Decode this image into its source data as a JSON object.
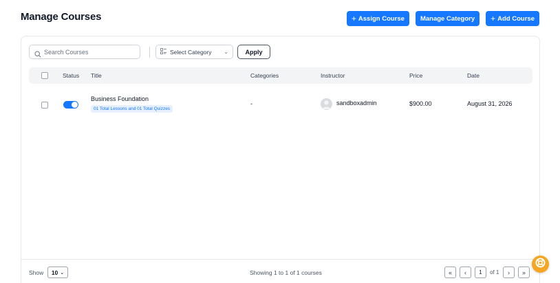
{
  "page": {
    "title": "Manage Courses"
  },
  "actions": {
    "assign_course": "Assign Course",
    "manage_category": "Manage Category",
    "add_course": "Add Course"
  },
  "filters": {
    "search_placeholder": "Search Courses",
    "category_select": "Select Category",
    "apply": "Apply"
  },
  "table": {
    "headers": {
      "status": "Status",
      "title": "Title",
      "categories": "Categories",
      "instructor": "Instructor",
      "price": "Price",
      "date": "Date"
    },
    "rows": [
      {
        "title": "Business Foundation",
        "summary": "01 Total Lessons and 01 Total Quizzes",
        "categories": "-",
        "instructor": "sandboxadmin",
        "price": "$900.00",
        "date": "August 31, 2026",
        "status_on": true
      }
    ]
  },
  "footer": {
    "show_label": "Show",
    "per_page": "10",
    "showing_text": "Showing 1 to 1 of 1 courses",
    "current_page": "1",
    "of_total": "of 1"
  },
  "colors": {
    "primary": "#1677ff",
    "fab": "#f6a623"
  },
  "icons": [
    "search-icon",
    "category-icon",
    "chevron-down-icon",
    "first-page-icon",
    "prev-page-icon",
    "next-page-icon",
    "last-page-icon",
    "help-icon"
  ]
}
